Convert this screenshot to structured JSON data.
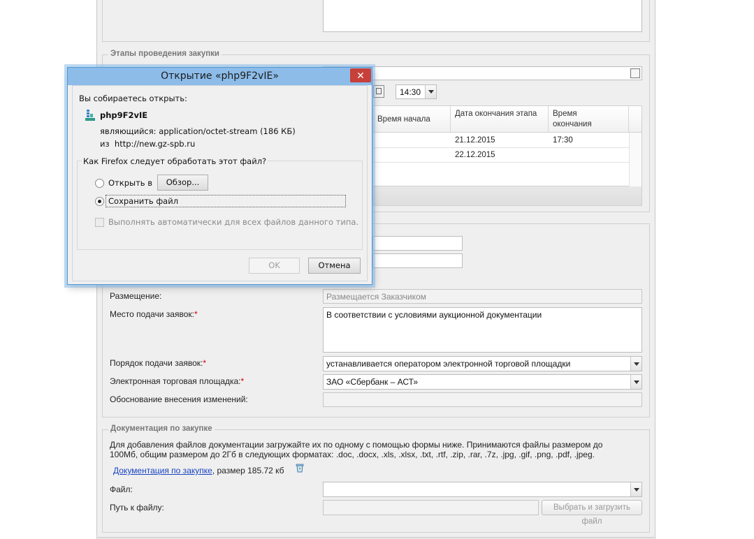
{
  "stages": {
    "legend": "Этапы проведения закупки",
    "time_value": "14:30",
    "table": {
      "headers": [
        "Время начала",
        "Дата окончания этапа",
        "Время окончания"
      ],
      "rows": [
        {
          "end_date": "21.12.2015",
          "end_time": "17:30"
        },
        {
          "end_date": "22.12.2015",
          "end_time": ""
        }
      ]
    }
  },
  "form": {
    "placement_label": "Размещение:",
    "placement_value": "Размещается Заказчиком",
    "place_label": "Место подачи заявок:",
    "place_value": "В соответствии с условиями аукционной документации",
    "order_label": "Порядок подачи заявок:",
    "order_value": "устанавливается оператором электронной торговой площадки",
    "etp_label": "Электронная торговая площадка:",
    "etp_value": "ЗАО «Сбербанк – АСТ»",
    "reason_label": "Обоснование внесения изменений:",
    "required_mark": "*"
  },
  "docs": {
    "legend": "Документация по закупке",
    "info_line1": "Для добавления файлов документации загружайте их по одному с помощью формы ниже. Принимаются файлы размером до",
    "info_line2": "100Мб, общим размером до 2Гб в следующих форматах: .doc, .docx, .xls, .xlsx, .txt, .rtf, .zip, .rar, .7z, .jpg, .gif, .png, .pdf, .jpeg.",
    "doc_link": "Документация по закупке",
    "doc_size": ", размер 185.72 кб",
    "file_label": "Файл:",
    "path_label": "Путь к файлу:",
    "upload_button": "Выбрать и загрузить файл"
  },
  "dialog": {
    "title": "Открытие «php9F2vIE»",
    "close": "✕",
    "intro": "Вы собираетесь открыть:",
    "filename": "php9F2vIE",
    "type_prefix": "являющийся:",
    "type_value": "application/octet-stream (186 КБ)",
    "from_prefix": "из",
    "from_value": "http://new.gz-spb.ru",
    "question": "Как Firefox следует обработать этот файл?",
    "open_with": "Открыть в",
    "browse": "Обзор...",
    "save_file": "Сохранить файл",
    "auto_label": "Выполнять автоматически для всех файлов данного типа.",
    "ok": "OK",
    "cancel": "Отмена"
  },
  "colors": {
    "dialog_titlebar": "#8dbce9",
    "close_button": "#c7403a",
    "required": "#d00000",
    "link": "#1a44c2"
  }
}
